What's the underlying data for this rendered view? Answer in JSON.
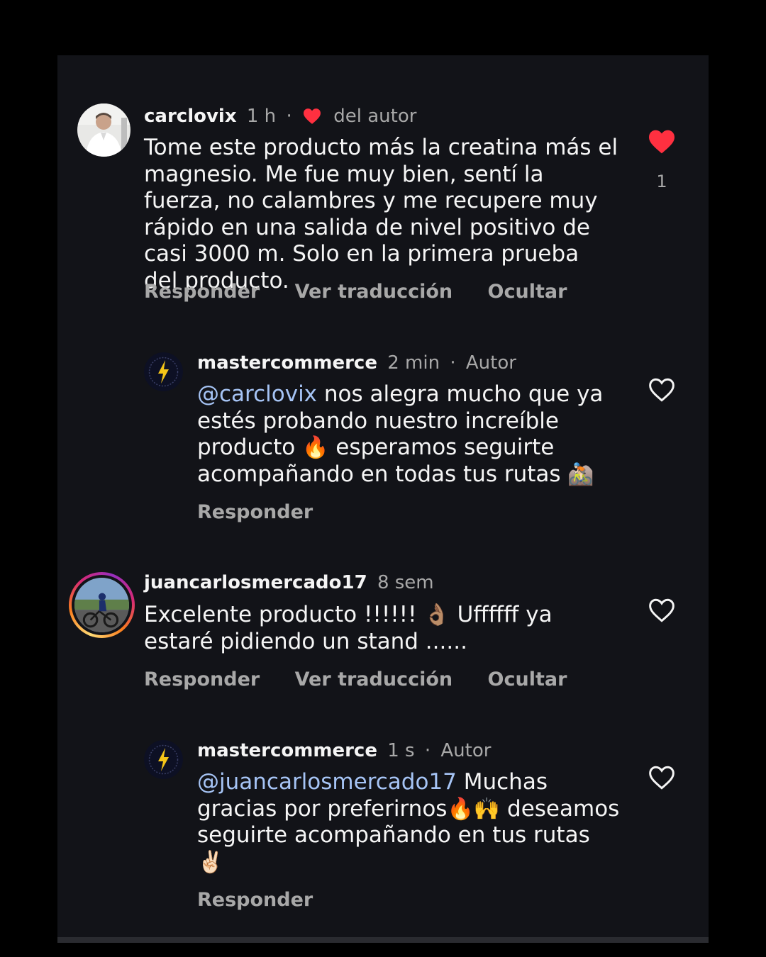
{
  "comments": [
    {
      "username": "carclovix",
      "time": "1 h",
      "separator": "·",
      "author_like_label": "del autor",
      "body": "Tome este producto más la creatina más el magnesio. Me fue muy bien, sentí la fuerza, no calambres y me recupere muy rápido en una salida de nivel positivo de casi 3000 m. Solo en la primera prueba del producto.",
      "actions": [
        "Responder",
        "Ver traducción",
        "Ocultar"
      ],
      "like_count": "1",
      "liked": true
    },
    {
      "username": "mastercommerce",
      "time": "2 min",
      "separator": "·",
      "role": "Autor",
      "mention": "@carclovix",
      "body_parts": [
        " nos alegra mucho que ya estés probando nuestro increíble producto ",
        "🔥",
        " esperamos seguirte acompañando en todas tus rutas ",
        "🚵🏻"
      ],
      "actions": [
        "Responder"
      ],
      "liked": false
    },
    {
      "username": "juancarlosmercado17",
      "time": "8 sem",
      "body_parts": [
        "Excelente producto !!!!!! ",
        "👌🏽",
        " Uffffff ya estaré pidiendo un stand ......"
      ],
      "actions": [
        "Responder",
        "Ver traducción",
        "Ocultar"
      ],
      "liked": false
    },
    {
      "username": "mastercommerce",
      "time": "1 s",
      "separator": "·",
      "role": "Autor",
      "mention": "@juancarlosmercado17",
      "body_parts": [
        " Muchas gracias por preferirnos",
        "🔥🙌",
        " deseamos seguirte acompañando en tus rutas ",
        "✌🏻"
      ],
      "actions": [
        "Responder"
      ],
      "liked": false
    }
  ],
  "colors": {
    "background": "#121318",
    "text": "#f5f5f5",
    "secondary": "#a8a8a8",
    "mention": "#a6c4f5",
    "like": "#ff3040"
  }
}
